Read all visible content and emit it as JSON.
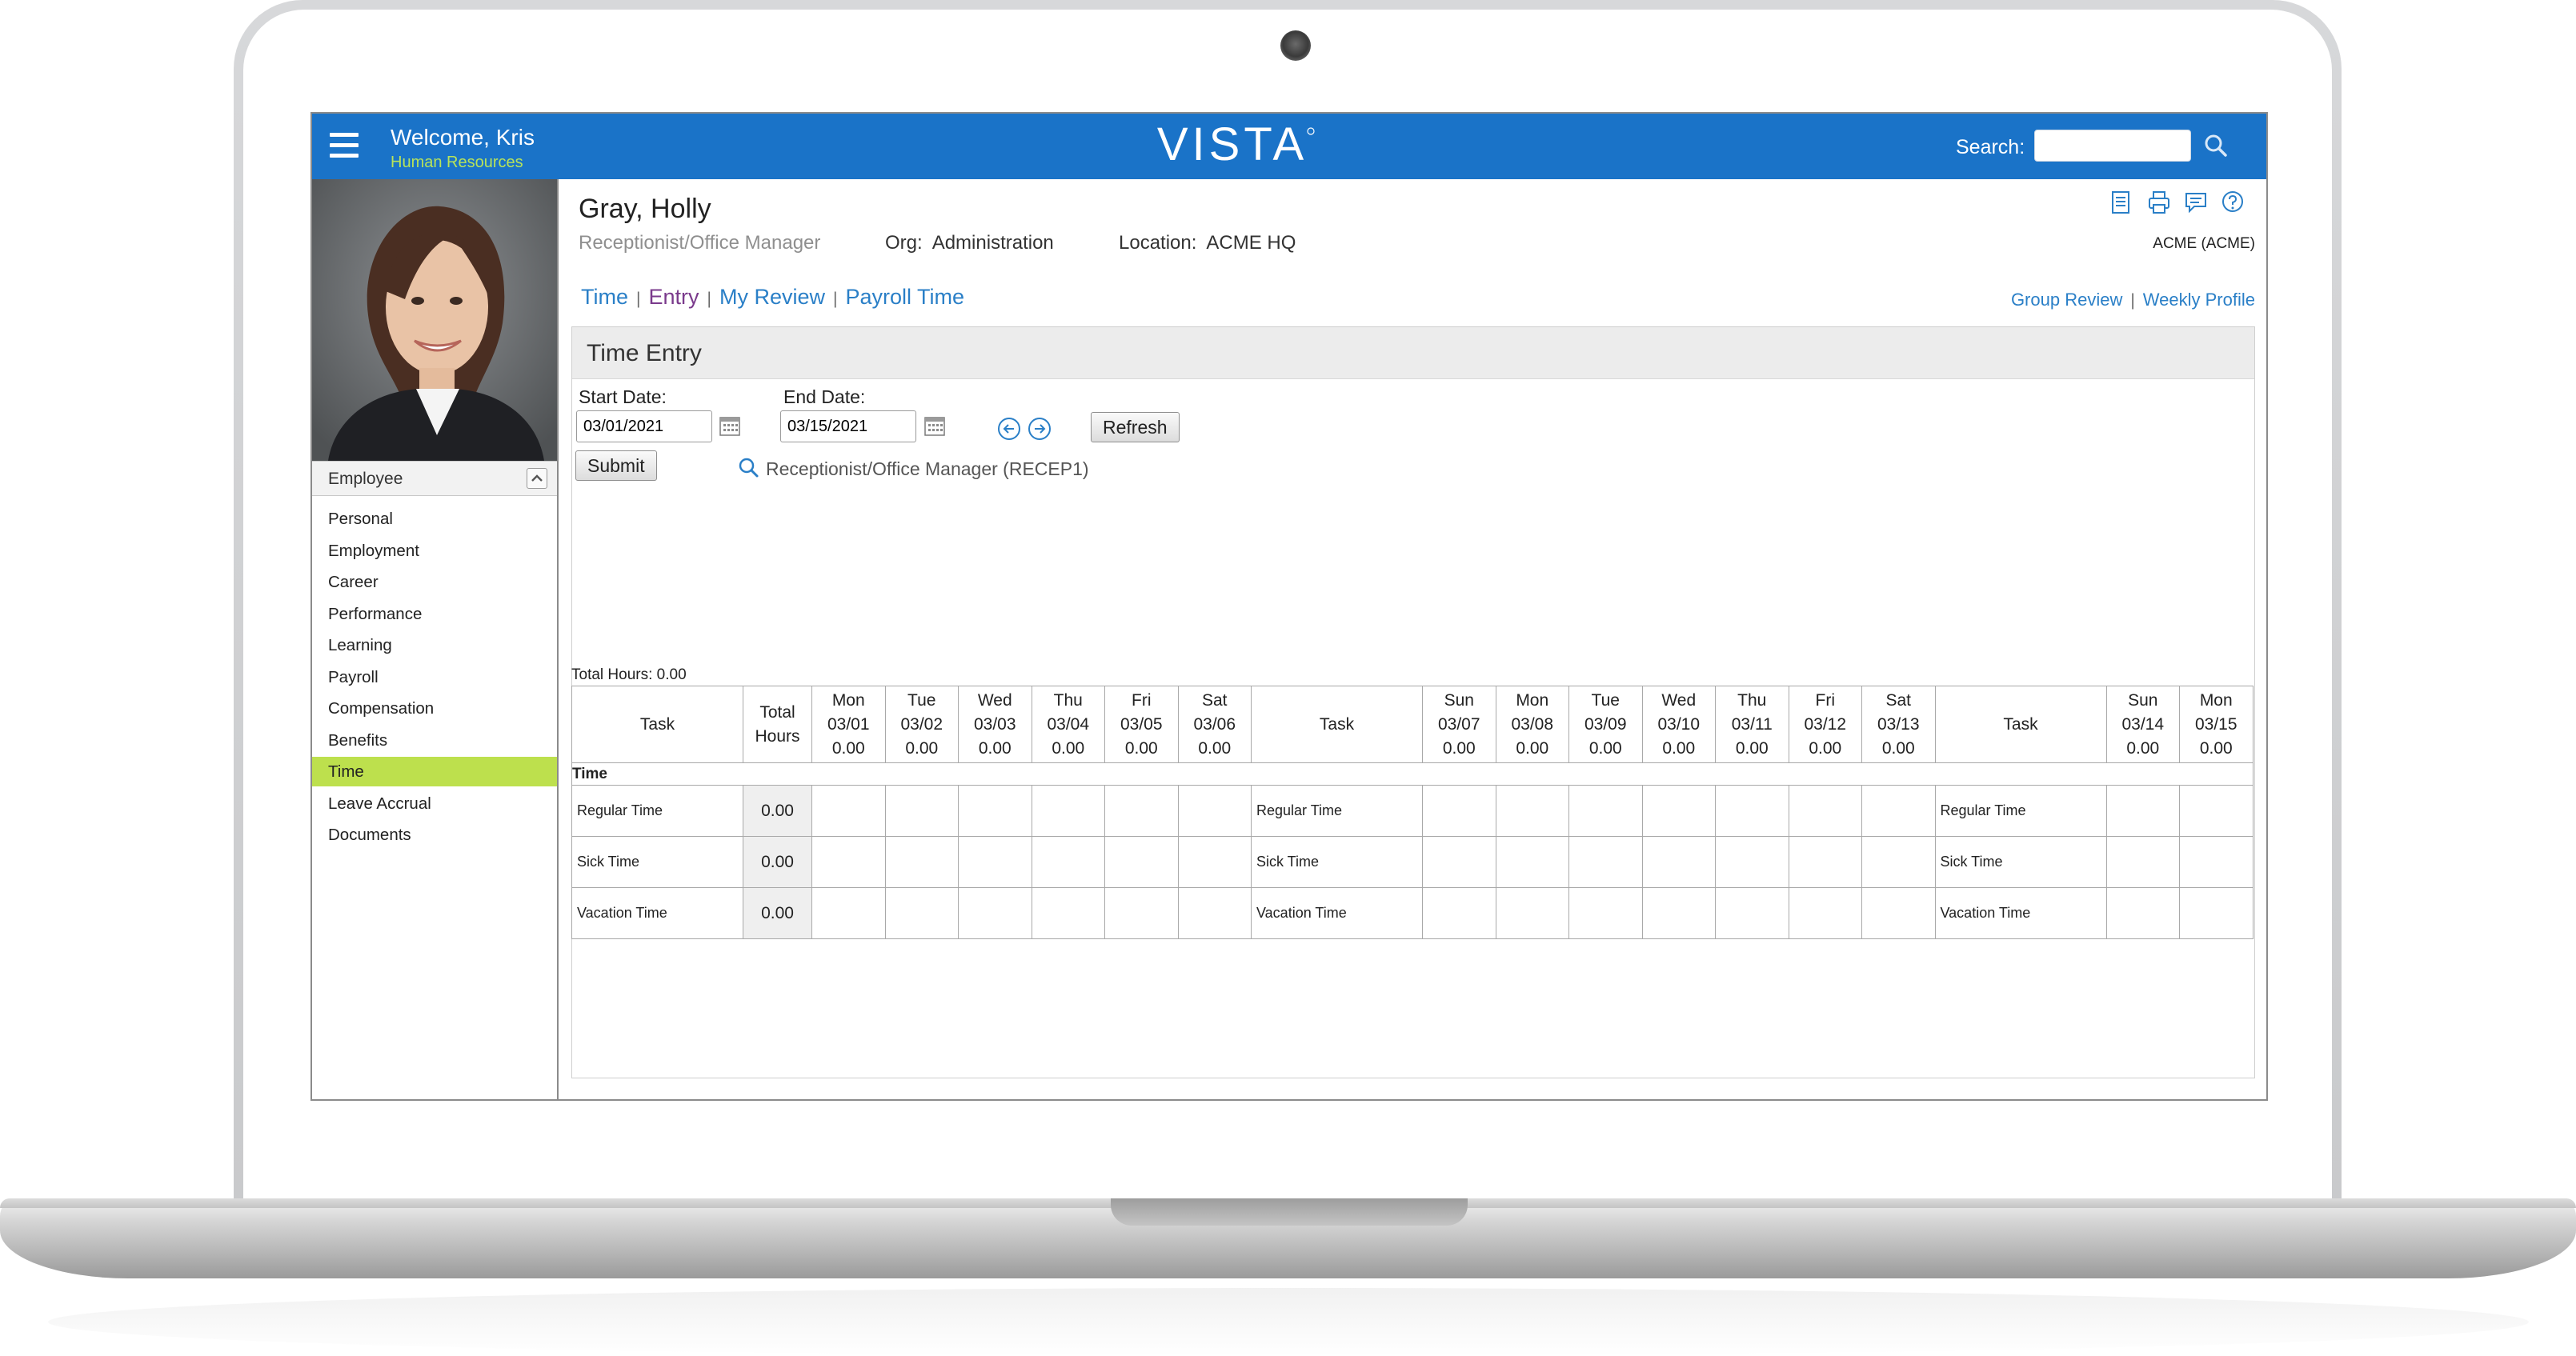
{
  "header": {
    "welcome": "Welcome, Kris",
    "department": "Human Resources",
    "logo": "VISTA",
    "search_label": "Search:",
    "search_value": ""
  },
  "sidebar": {
    "section_label": "Employee",
    "items": [
      {
        "label": "Personal",
        "active": false
      },
      {
        "label": "Employment",
        "active": false
      },
      {
        "label": "Career",
        "active": false
      },
      {
        "label": "Performance",
        "active": false
      },
      {
        "label": "Learning",
        "active": false
      },
      {
        "label": "Payroll",
        "active": false
      },
      {
        "label": "Compensation",
        "active": false
      },
      {
        "label": "Benefits",
        "active": false
      },
      {
        "label": "Time",
        "active": true
      },
      {
        "label": "Leave Accrual",
        "active": false
      },
      {
        "label": "Documents",
        "active": false
      }
    ]
  },
  "employee": {
    "name": "Gray, Holly",
    "title": "Receptionist/Office Manager",
    "org_label": "Org:",
    "org": "Administration",
    "location_label": "Location:",
    "location": "ACME HQ",
    "company": "ACME (ACME)"
  },
  "toolbar_icons": [
    "report-icon",
    "print-icon",
    "comment-icon",
    "help-icon"
  ],
  "tabs": [
    {
      "label": "Time",
      "active": false
    },
    {
      "label": "Entry",
      "active": true
    },
    {
      "label": "My Review",
      "active": false
    },
    {
      "label": "Payroll Time",
      "active": false
    }
  ],
  "right_links": [
    "Group Review",
    "Weekly Profile"
  ],
  "time_entry": {
    "title": "Time Entry",
    "start_date_label": "Start Date:",
    "start_date": "03/01/2021",
    "end_date_label": "End Date:",
    "end_date": "03/15/2021",
    "refresh_label": "Refresh",
    "submit_label": "Submit",
    "position": "Receptionist/Office Manager (RECEP1)",
    "total_hours_label": "Total Hours: 0.00"
  },
  "grid": {
    "task_header": "Task",
    "total_header_1": "Total",
    "total_header_2": "Hours",
    "section": "Time",
    "days_block1": [
      {
        "day": "Mon",
        "date": "03/01",
        "hours": "0.00"
      },
      {
        "day": "Tue",
        "date": "03/02",
        "hours": "0.00"
      },
      {
        "day": "Wed",
        "date": "03/03",
        "hours": "0.00"
      },
      {
        "day": "Thu",
        "date": "03/04",
        "hours": "0.00"
      },
      {
        "day": "Fri",
        "date": "03/05",
        "hours": "0.00"
      },
      {
        "day": "Sat",
        "date": "03/06",
        "hours": "0.00"
      }
    ],
    "days_block2": [
      {
        "day": "Sun",
        "date": "03/07",
        "hours": "0.00"
      },
      {
        "day": "Mon",
        "date": "03/08",
        "hours": "0.00"
      },
      {
        "day": "Tue",
        "date": "03/09",
        "hours": "0.00"
      },
      {
        "day": "Wed",
        "date": "03/10",
        "hours": "0.00"
      },
      {
        "day": "Thu",
        "date": "03/11",
        "hours": "0.00"
      },
      {
        "day": "Fri",
        "date": "03/12",
        "hours": "0.00"
      },
      {
        "day": "Sat",
        "date": "03/13",
        "hours": "0.00"
      }
    ],
    "days_block3": [
      {
        "day": "Sun",
        "date": "03/14",
        "hours": "0.00"
      },
      {
        "day": "Mon",
        "date": "03/15",
        "hours": "0.00"
      }
    ],
    "rows": [
      {
        "task": "Regular Time",
        "total": "0.00"
      },
      {
        "task": "Sick Time",
        "total": "0.00"
      },
      {
        "task": "Vacation Time",
        "total": "0.00"
      }
    ]
  },
  "colors": {
    "topbar": "#1a73c8",
    "active_nav": "#bde04d",
    "link": "#2a7fc7",
    "active_tab": "#7a3a8c"
  }
}
